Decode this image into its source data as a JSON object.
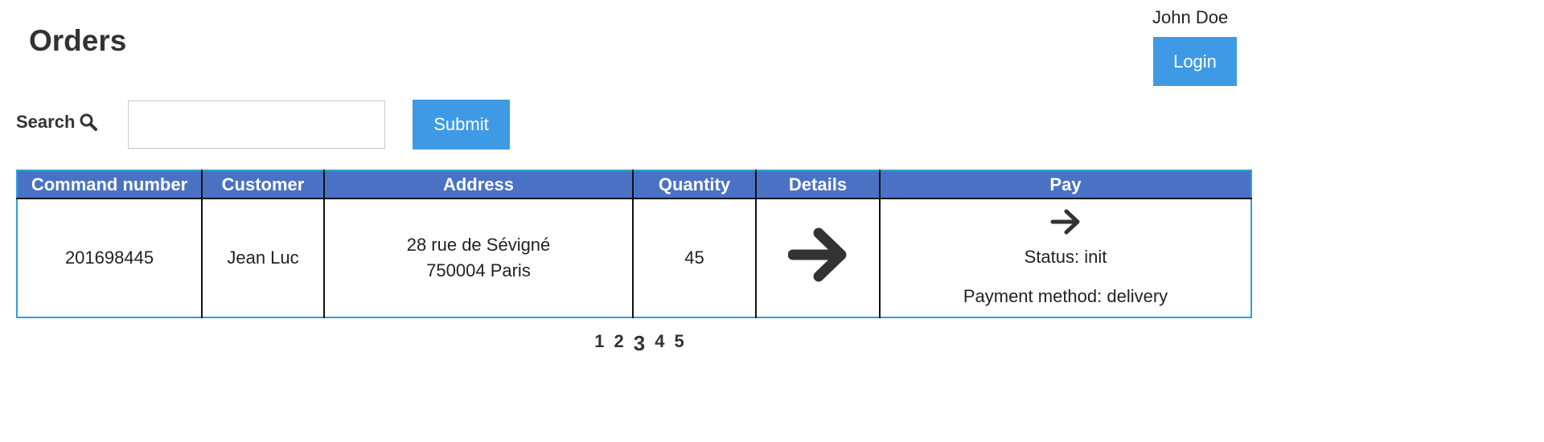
{
  "header": {
    "title": "Orders",
    "user_name": "John Doe",
    "login_label": "Login"
  },
  "search": {
    "label": "Search",
    "icon": "search-icon",
    "value": "",
    "placeholder": "",
    "submit_label": "Submit"
  },
  "table": {
    "columns": [
      "Command number",
      "Customer",
      "Address",
      "Quantity",
      "Details",
      "Pay"
    ],
    "rows": [
      {
        "command_number": "201698445",
        "customer": "Jean Luc",
        "address_line1": "28 rue de Sévigné",
        "address_line2": "750004 Paris",
        "quantity": "45",
        "details_icon": "arrow-right-icon",
        "pay_icon": "arrow-right-icon",
        "status": "Status: init",
        "payment_method": "Payment method: delivery"
      }
    ]
  },
  "pagination": {
    "pages": [
      "1",
      "2",
      "3",
      "4",
      "5"
    ],
    "current": "3"
  },
  "colors": {
    "accent": "#3f9ae5",
    "table_header": "#4a72c4",
    "table_border": "#2f9fd9",
    "text": "#333333"
  }
}
